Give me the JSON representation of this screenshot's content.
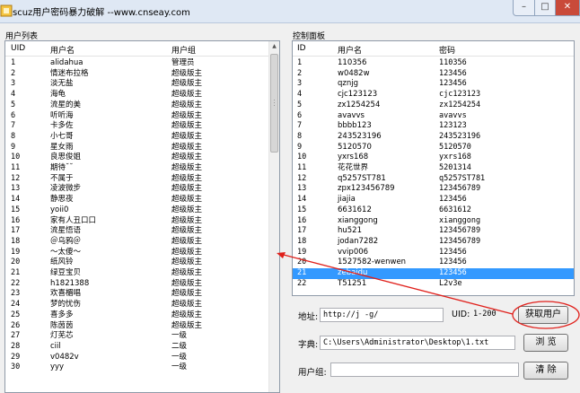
{
  "window": {
    "title": "scuz用户密码暴力破解  --www.cnseay.com",
    "min": "–",
    "max": "□",
    "close": "✕"
  },
  "user_list": {
    "label": "用户列表",
    "columns": [
      "UID",
      "用户名",
      "用户组"
    ],
    "rows": [
      [
        "1",
        "alidahua",
        "管理员"
      ],
      [
        "2",
        "情迷布拉格",
        "超级版主"
      ],
      [
        "3",
        "淡无盐",
        "超级版主"
      ],
      [
        "4",
        "海龟",
        "超级版主"
      ],
      [
        "5",
        "流星的美",
        "超级版主"
      ],
      [
        "6",
        "听听海",
        "超级版主"
      ],
      [
        "7",
        "卡多佐",
        "超级版主"
      ],
      [
        "8",
        "小七哥",
        "超级版主"
      ],
      [
        "9",
        "星女雨",
        "超级版主"
      ],
      [
        "10",
        "良思俊姐",
        "超级版主"
      ],
      [
        "11",
        "期待˘˘",
        "超级版主"
      ],
      [
        "12",
        "不属于",
        "超级版主"
      ],
      [
        "13",
        "凌波微步",
        "超级版主"
      ],
      [
        "14",
        "静思夜",
        "超级版主"
      ],
      [
        "15",
        "yoii0",
        "超级版主"
      ],
      [
        "16",
        "家有人丑口口",
        "超级版主"
      ],
      [
        "17",
        "流星悟语",
        "超级版主"
      ],
      [
        "18",
        "＠乌鸦＠",
        "超级版主"
      ],
      [
        "19",
        "〜太傻〜",
        "超级版主"
      ],
      [
        "20",
        "纸风铃",
        "超级版主"
      ],
      [
        "21",
        "绿豆宝贝",
        "超级版主"
      ],
      [
        "22",
        "h1821388",
        "超级版主"
      ],
      [
        "23",
        "欢喜楣唱",
        "超级版主"
      ],
      [
        "24",
        "梦的忧伤",
        "超级版主"
      ],
      [
        "25",
        "喜多多",
        "超级版主"
      ],
      [
        "26",
        "陈茵茵",
        "超级版主"
      ],
      [
        "27",
        "灯芜芯",
        "一级"
      ],
      [
        "28",
        "ciil",
        "二级"
      ],
      [
        "29",
        "v0482v",
        "一级"
      ],
      [
        "30",
        "yyy",
        "一级"
      ]
    ]
  },
  "control_panel": {
    "label": "控制面板",
    "columns": [
      "ID",
      "用户名",
      "密码"
    ],
    "rows": [
      [
        "1",
        "110356",
        "110356"
      ],
      [
        "2",
        "w0482w",
        "123456"
      ],
      [
        "3",
        "qznjg",
        "123456"
      ],
      [
        "4",
        "cjc123123",
        "cjc123123"
      ],
      [
        "5",
        "zx1254254",
        "zx1254254"
      ],
      [
        "6",
        "avavvs",
        "avavvs"
      ],
      [
        "7",
        "bbbb123",
        "123123"
      ],
      [
        "8",
        "243523196",
        "243523196"
      ],
      [
        "9",
        "5120570",
        "5120570"
      ],
      [
        "10",
        "yxrs168",
        "yxrs168"
      ],
      [
        "11",
        "花花世界",
        "5201314"
      ],
      [
        "12",
        "q5257ST781",
        "q5257ST781"
      ],
      [
        "13",
        "zpx123456789",
        "123456789"
      ],
      [
        "14",
        "jiajia",
        "123456"
      ],
      [
        "15",
        "6631612",
        "6631612"
      ],
      [
        "16",
        "xianggong",
        "xianggong"
      ],
      [
        "17",
        "hu521",
        "123456789"
      ],
      [
        "18",
        "jodan7282",
        "123456789"
      ],
      [
        "19",
        "vvip006",
        "123456"
      ],
      [
        "20",
        "1527582-wenwen",
        "123456"
      ],
      [
        "21",
        "zebaidu",
        "123456"
      ],
      [
        "22",
        "T51251",
        "L2v3e"
      ]
    ],
    "selected_index": 20
  },
  "address": {
    "label": "地址:",
    "value": "http://j         -g/"
  },
  "uid": {
    "label": "UID:",
    "value": "1-200"
  },
  "fetch_button": "获取用户",
  "dict": {
    "label": "字典:",
    "value": "C:\\Users\\Administrator\\Desktop\\1.txt"
  },
  "browse_button": "浏 览",
  "group": {
    "label": "用户组:",
    "value": ""
  },
  "clear_button": "清 除",
  "annotation_color": "#e0201b",
  "selection_color": "#3399ff"
}
